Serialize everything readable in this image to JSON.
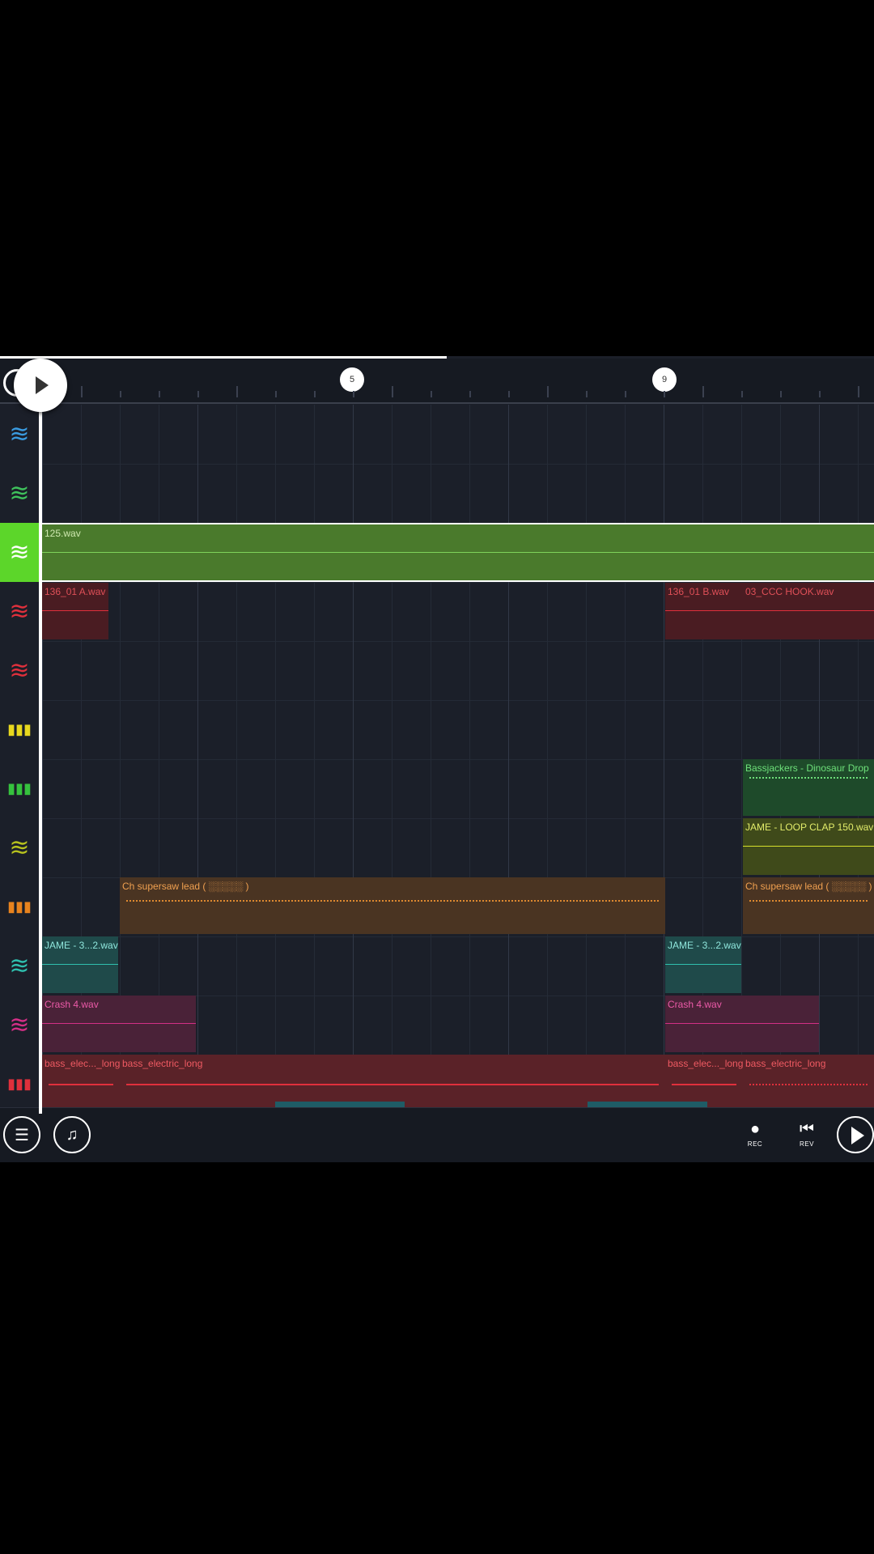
{
  "ruler": {
    "markers": [
      "5",
      "9"
    ]
  },
  "tracks": [
    {
      "id": "t1",
      "icon": "waveform-icon",
      "color": "#3a9be0"
    },
    {
      "id": "t2",
      "icon": "waveform-icon",
      "color": "#3fc25c"
    },
    {
      "id": "t3",
      "icon": "waveform-icon",
      "color": "#ffffff",
      "selected": true
    },
    {
      "id": "t4",
      "icon": "waveform-icon",
      "color": "#e0303c"
    },
    {
      "id": "t5",
      "icon": "waveform-icon",
      "color": "#e0303c"
    },
    {
      "id": "t6",
      "icon": "piano-icon",
      "color": "#e8d81e"
    },
    {
      "id": "t7",
      "icon": "piano-icon",
      "color": "#36c23e"
    },
    {
      "id": "t8",
      "icon": "waveform-icon",
      "color": "#b7c21e"
    },
    {
      "id": "t9",
      "icon": "piano-icon",
      "color": "#e8831e"
    },
    {
      "id": "t10",
      "icon": "waveform-icon",
      "color": "#2fbfae"
    },
    {
      "id": "t11",
      "icon": "waveform-icon",
      "color": "#d32f86"
    },
    {
      "id": "t12",
      "icon": "piano-icon",
      "color": "#e0303c"
    }
  ],
  "clips": {
    "c125": "125.wav",
    "c136a": "136_01 A.wav",
    "c136b": "136_01 B.wav",
    "cccc": "03_CCC HOOK.wav",
    "cbass_jack": "Bassjackers - Dinosaur Drop",
    "cjame_loop": "JAME - LOOP CLAP 150.wav",
    "csuper1": "Ch supersaw lead ( ░░░░░ )",
    "csuper2": "Ch supersaw lead ( ░░░░░ )",
    "cjame1": "JAME - 3...2.wav",
    "cjame2": "JAME - 3...2.wav",
    "ccrash1": "Crash 4.wav",
    "ccrash2": "Crash 4.wav",
    "cbass1": "bass_elec..._long",
    "cbass2": "bass_electric_long",
    "cbass3": "bass_elec..._long",
    "cbass4": "bass_electric_long"
  },
  "transport": {
    "rec_label": "REC",
    "rev_label": "REV"
  },
  "colors": {
    "background": "#1b1f29",
    "selected_track": "#5cd62a",
    "clip_green": "#4a7a2c",
    "clip_red": "#5a2228",
    "clip_orange": "#4a3422",
    "clip_teal": "#1f4a4a",
    "clip_pink": "#4a2238"
  }
}
